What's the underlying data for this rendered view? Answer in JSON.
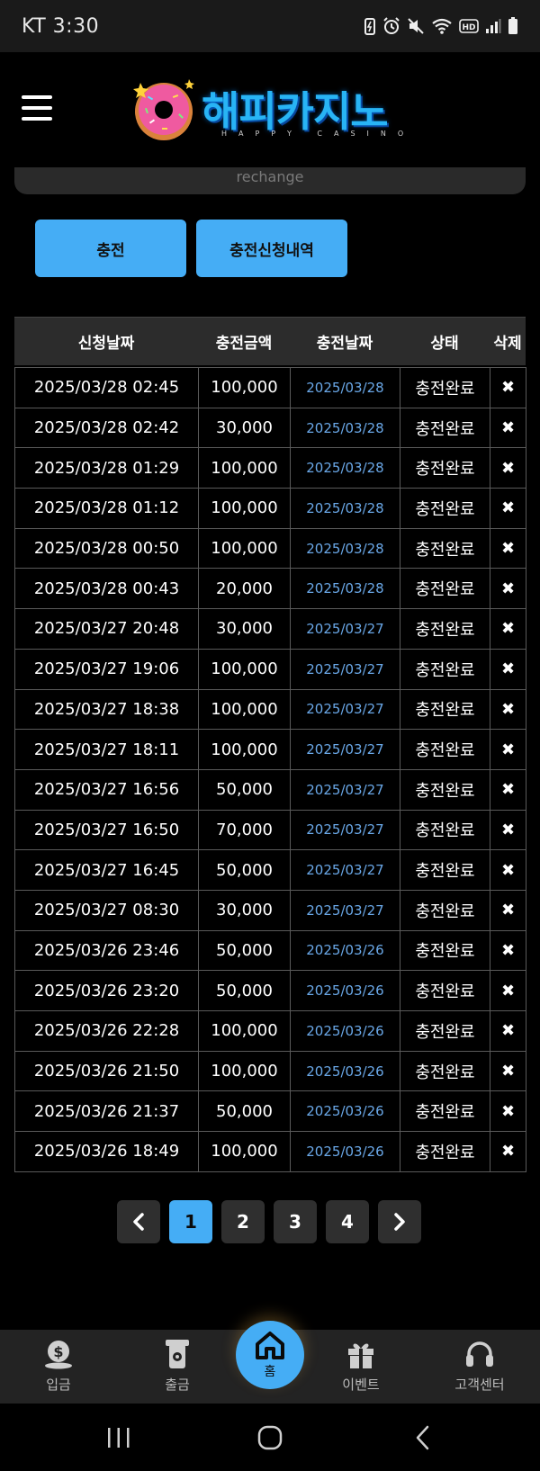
{
  "status_bar": {
    "carrier": "KT",
    "time": "3:30"
  },
  "header": {
    "logo_text": "해피카지노",
    "logo_sub": "HAPPY CASINO"
  },
  "rechange_label": "rechange",
  "buttons": {
    "charge": "충전",
    "history": "충전신청내역"
  },
  "table": {
    "headers": [
      "신청날짜",
      "충전금액",
      "충전날짜",
      "상태",
      "삭제"
    ],
    "rows": [
      {
        "date": "2025/03/28 02:45",
        "amount": "100,000",
        "cdate": "2025/03/28",
        "status": "충전완료"
      },
      {
        "date": "2025/03/28 02:42",
        "amount": "30,000",
        "cdate": "2025/03/28",
        "status": "충전완료"
      },
      {
        "date": "2025/03/28 01:29",
        "amount": "100,000",
        "cdate": "2025/03/28",
        "status": "충전완료"
      },
      {
        "date": "2025/03/28 01:12",
        "amount": "100,000",
        "cdate": "2025/03/28",
        "status": "충전완료"
      },
      {
        "date": "2025/03/28 00:50",
        "amount": "100,000",
        "cdate": "2025/03/28",
        "status": "충전완료"
      },
      {
        "date": "2025/03/28 00:43",
        "amount": "20,000",
        "cdate": "2025/03/28",
        "status": "충전완료"
      },
      {
        "date": "2025/03/27 20:48",
        "amount": "30,000",
        "cdate": "2025/03/27",
        "status": "충전완료"
      },
      {
        "date": "2025/03/27 19:06",
        "amount": "100,000",
        "cdate": "2025/03/27",
        "status": "충전완료"
      },
      {
        "date": "2025/03/27 18:38",
        "amount": "100,000",
        "cdate": "2025/03/27",
        "status": "충전완료"
      },
      {
        "date": "2025/03/27 18:11",
        "amount": "100,000",
        "cdate": "2025/03/27",
        "status": "충전완료"
      },
      {
        "date": "2025/03/27 16:56",
        "amount": "50,000",
        "cdate": "2025/03/27",
        "status": "충전완료"
      },
      {
        "date": "2025/03/27 16:50",
        "amount": "70,000",
        "cdate": "2025/03/27",
        "status": "충전완료"
      },
      {
        "date": "2025/03/27 16:45",
        "amount": "50,000",
        "cdate": "2025/03/27",
        "status": "충전완료"
      },
      {
        "date": "2025/03/27 08:30",
        "amount": "30,000",
        "cdate": "2025/03/27",
        "status": "충전완료"
      },
      {
        "date": "2025/03/26 23:46",
        "amount": "50,000",
        "cdate": "2025/03/26",
        "status": "충전완료"
      },
      {
        "date": "2025/03/26 23:20",
        "amount": "50,000",
        "cdate": "2025/03/26",
        "status": "충전완료"
      },
      {
        "date": "2025/03/26 22:28",
        "amount": "100,000",
        "cdate": "2025/03/26",
        "status": "충전완료"
      },
      {
        "date": "2025/03/26 21:50",
        "amount": "100,000",
        "cdate": "2025/03/26",
        "status": "충전완료"
      },
      {
        "date": "2025/03/26 21:37",
        "amount": "50,000",
        "cdate": "2025/03/26",
        "status": "충전완료"
      },
      {
        "date": "2025/03/26 18:49",
        "amount": "100,000",
        "cdate": "2025/03/26",
        "status": "충전완료"
      }
    ],
    "delete_glyph": "✖"
  },
  "pagination": {
    "pages": [
      "1",
      "2",
      "3",
      "4"
    ],
    "current": "1"
  },
  "bottom_nav": {
    "deposit": "입금",
    "withdraw": "출금",
    "home": "홈",
    "event": "이벤트",
    "support": "고객센터"
  },
  "colors": {
    "accent": "#45adf5",
    "link_date": "#6aa8e8",
    "table_border": "#5a5a5a"
  }
}
